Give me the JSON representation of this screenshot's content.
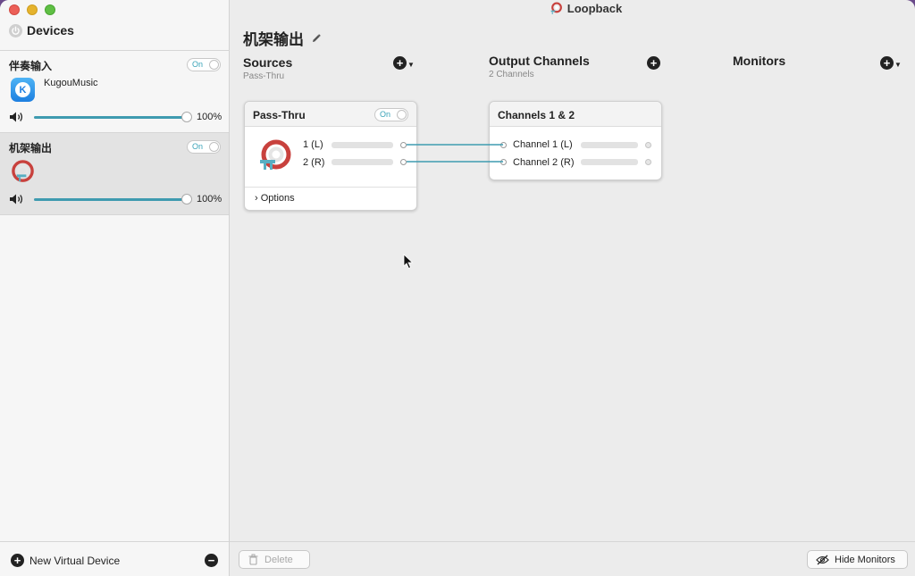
{
  "window": {
    "title": "Loopback"
  },
  "sidebar": {
    "title": "Devices",
    "devices": [
      {
        "name": "伴奏输入",
        "toggle": "On",
        "app_label": "KugouMusic",
        "volume": "100%"
      },
      {
        "name": "机架输出",
        "toggle": "On",
        "volume": "100%"
      }
    ],
    "new_device_label": "New Virtual Device"
  },
  "main": {
    "device_name": "机架输出",
    "sources": {
      "title": "Sources",
      "subtitle": "Pass-Thru"
    },
    "output_channels": {
      "title": "Output Channels",
      "subtitle": "2 Channels"
    },
    "monitors": {
      "title": "Monitors"
    },
    "passthru_card": {
      "title": "Pass-Thru",
      "toggle": "On",
      "channels": [
        "1 (L)",
        "2 (R)"
      ],
      "options": "Options"
    },
    "channels_card": {
      "title": "Channels 1 & 2",
      "channels": [
        "Channel 1 (L)",
        "Channel 2 (R)"
      ]
    }
  },
  "bottom": {
    "delete_label": "Delete",
    "hide_monitors_label": "Hide Monitors"
  },
  "colors": {
    "accent": "#3f9bb0",
    "loopback_red": "#c8413d"
  },
  "icons": [
    "power-icon",
    "pencil-icon",
    "speaker-icon",
    "plus-circle-icon",
    "minus-circle-icon",
    "trash-icon",
    "eye-slash-icon",
    "loopback-icon",
    "kugou-app-icon"
  ]
}
